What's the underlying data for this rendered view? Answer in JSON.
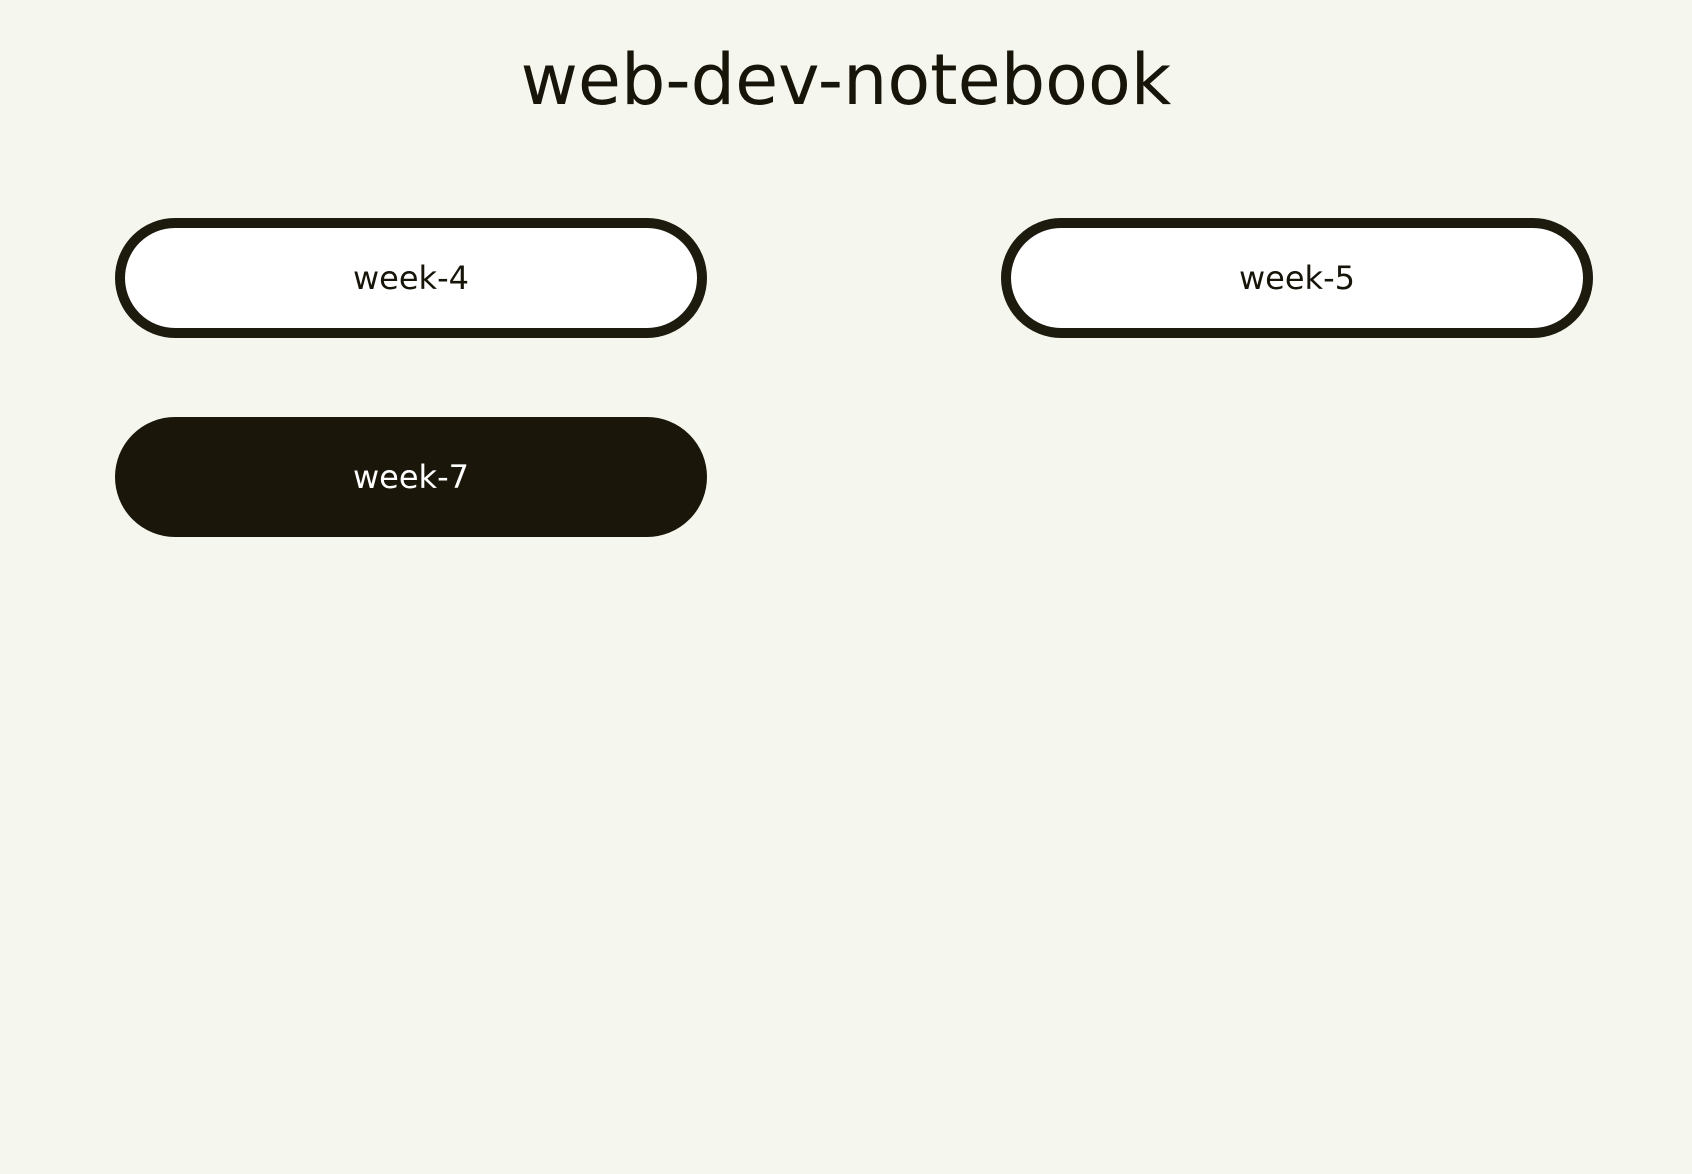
{
  "header": {
    "title": "web-dev-notebook"
  },
  "weeks": [
    {
      "label": "week-4",
      "style": "outline"
    },
    {
      "label": "week-5",
      "style": "outline"
    },
    {
      "label": "week-7",
      "style": "filled"
    }
  ],
  "colors": {
    "background": "#f5f6ee",
    "ink": "#1a160a",
    "button_fill_light": "#ffffff",
    "button_text_dark": "#ffffff"
  }
}
